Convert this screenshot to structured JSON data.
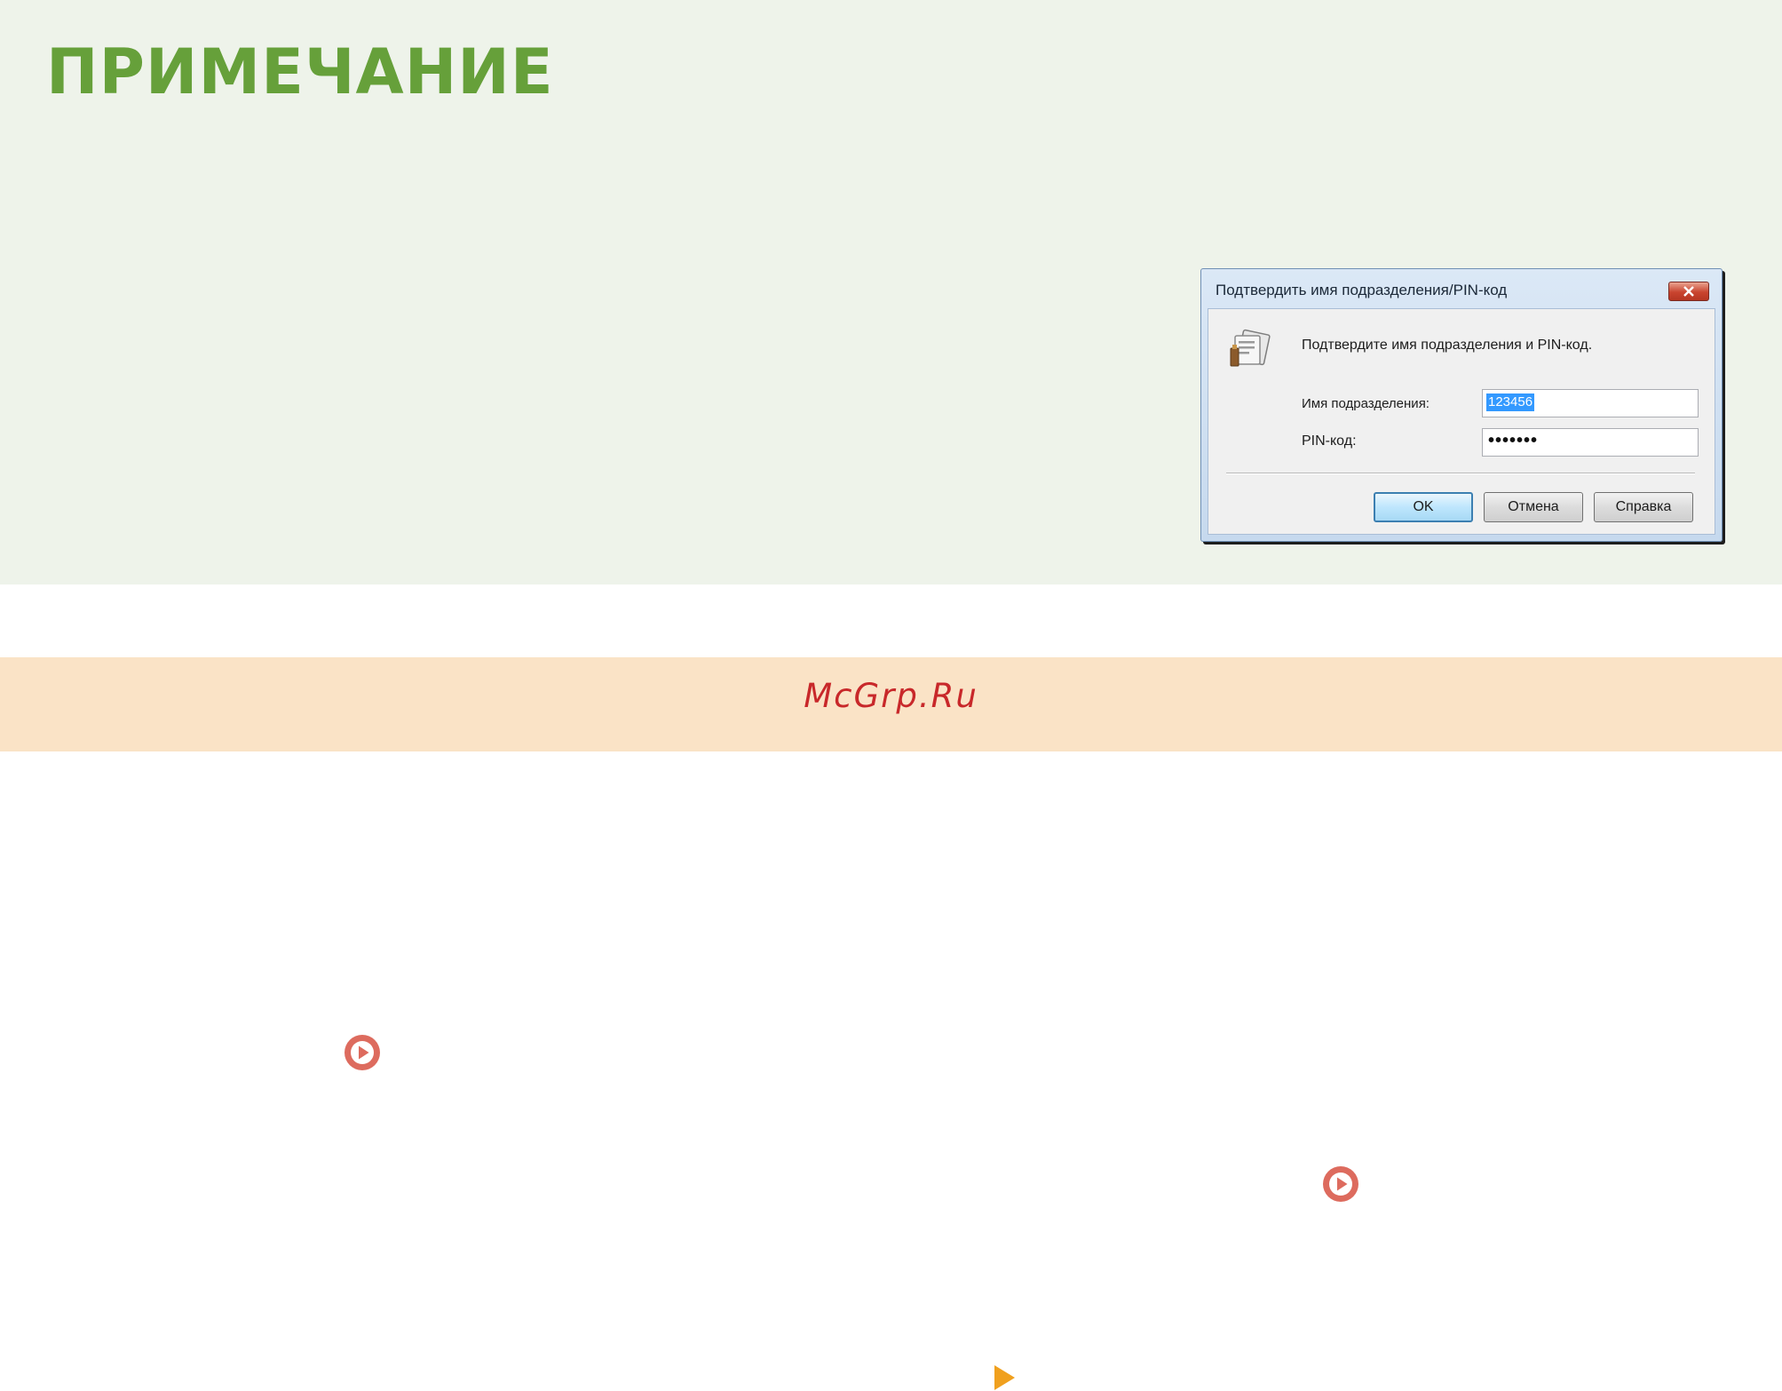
{
  "note": {
    "title": "ПРИМЕЧАНИЕ"
  },
  "dialog": {
    "title": "Подтвердить имя подразделения/PIN-код",
    "icon": "department-id-icon",
    "prompt": "Подтвердите имя подразделения и PIN-код.",
    "department_label": "Имя подразделения:",
    "department_value": "123456",
    "pin_label": "PIN-код:",
    "pin_value": "•••••••",
    "ok_label": "OK",
    "cancel_label": "Отмена",
    "help_label": "Справка"
  },
  "watermark": {
    "text": "McGrp.Ru"
  },
  "icons": {
    "link_arrow": "circle-play-icon",
    "next_page": "triangle-right-icon"
  },
  "colors": {
    "note_title": "#66a03a",
    "note_background": "#eef3ea",
    "watermark_band": "#fae3c6",
    "watermark_text": "#c8282a",
    "link_icon": "#dd6b5e",
    "next_arrow": "#f0a01e"
  }
}
